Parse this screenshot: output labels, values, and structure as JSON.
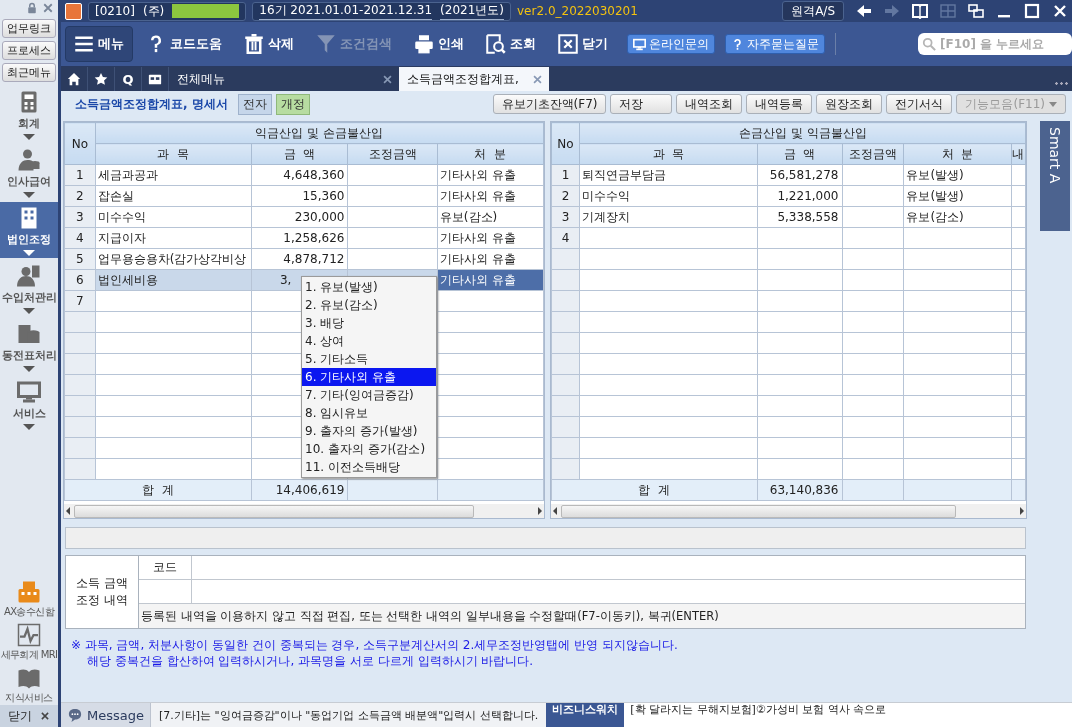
{
  "title_bar": {
    "company_code": "[0210]",
    "company": "(주)",
    "period": "16기  2021.01.01-2021.12.31",
    "fiscal_year": "(2021년도)",
    "version": "ver2.0_2022030201",
    "remote_button": "원격A/S"
  },
  "sidebar": {
    "quick_buttons": [
      "업무링크",
      "프로세스",
      "최근메뉴"
    ],
    "items": [
      {
        "label": "회계",
        "kind": "calculator",
        "selected": false
      },
      {
        "label": "인사급여",
        "kind": "person",
        "selected": false
      },
      {
        "label": "법인조정",
        "kind": "building",
        "selected": true
      },
      {
        "label": "수입처관리",
        "kind": "people",
        "selected": false
      },
      {
        "label": "동전표처리",
        "kind": "database",
        "selected": false
      },
      {
        "label": "서비스",
        "kind": "monitor",
        "selected": false
      }
    ],
    "bottom_items": [
      {
        "label": "AX송수신함",
        "kind": "fax"
      },
      {
        "label": "세무회계 MRI",
        "kind": "pulse"
      },
      {
        "label": "지식서비스",
        "kind": "book"
      }
    ],
    "close": "닫기"
  },
  "toolbar": {
    "buttons": [
      {
        "label": "메뉴",
        "kind": "menu",
        "disabled": false
      },
      {
        "label": "코드도움",
        "kind": "question",
        "disabled": false
      },
      {
        "label": "삭제",
        "kind": "trash",
        "disabled": false
      },
      {
        "label": "조건검색",
        "kind": "filter",
        "disabled": true
      },
      {
        "label": "인쇄",
        "kind": "printer",
        "disabled": false
      },
      {
        "label": "조회",
        "kind": "lookup",
        "disabled": false
      },
      {
        "label": "닫기",
        "kind": "closebox",
        "disabled": false
      }
    ],
    "help_buttons": [
      {
        "label": "온라인문의",
        "kind": "monitor"
      },
      {
        "label": "자주묻는질문",
        "kind": "question"
      }
    ],
    "search": {
      "placeholder": "[F10] 을 누르세요"
    }
  },
  "tab_bar": {
    "quick_search": "Q",
    "tabs": [
      {
        "label": "전체메뉴",
        "selected": false
      },
      {
        "label": "소득금액조정합계표,",
        "selected": true
      }
    ]
  },
  "form": {
    "title": "소득금액조정합계표, 명세서",
    "badges": [
      {
        "label": "전자",
        "kind": "plain"
      },
      {
        "label": "개정",
        "kind": "green"
      }
    ],
    "buttons": [
      {
        "label": "유보기초잔액(F7)",
        "disabled": false
      },
      {
        "label": "저장",
        "disabled": false
      },
      {
        "label": "내역조회",
        "disabled": false
      },
      {
        "label": "내역등록",
        "disabled": false
      },
      {
        "label": "원장조회",
        "disabled": false
      },
      {
        "label": "전기서식",
        "disabled": false
      },
      {
        "label": "기능모음(F11)",
        "disabled": true
      }
    ]
  },
  "left_table": {
    "group_header": "익금산입 및 손금불산입",
    "columns": [
      "No",
      "과  목",
      "금  액",
      "조정금액",
      "처  분"
    ],
    "rows": [
      {
        "no": "1",
        "subject": "세금과공과",
        "amount": "4,648,360",
        "disposal": "기타사외 유출",
        "selected": false
      },
      {
        "no": "2",
        "subject": "잡손실",
        "amount": "15,360",
        "disposal": "기타사외 유출",
        "selected": false
      },
      {
        "no": "3",
        "subject": "미수수익",
        "amount": "230,000",
        "disposal": "유보(감소)",
        "selected": false
      },
      {
        "no": "4",
        "subject": "지급이자",
        "amount": "1,258,626",
        "disposal": "기타사외 유출",
        "selected": false
      },
      {
        "no": "5",
        "subject": "업무용승용차(감가상각비상",
        "amount": "4,878,712",
        "disposal": "기타사외 유출",
        "selected": false
      },
      {
        "no": "6",
        "subject": "법인세비용",
        "amount": "3,",
        "disposal": "기타사외 유출",
        "selected": true
      },
      {
        "no": "7",
        "selected": false
      }
    ],
    "total_label": "합  계",
    "total": "14,406,619"
  },
  "disposal_dropdown": {
    "items": [
      {
        "label": "1. 유보(발생)",
        "selected": false
      },
      {
        "label": "2. 유보(감소)",
        "selected": false
      },
      {
        "label": "3. 배당",
        "selected": false
      },
      {
        "label": "4. 상여",
        "selected": false
      },
      {
        "label": "5. 기타소득",
        "selected": false
      },
      {
        "label": "6. 기타사외 유출",
        "selected": true
      },
      {
        "label": "7. 기타(잉여금증감)",
        "selected": false
      },
      {
        "label": "8. 임시유보",
        "selected": false
      },
      {
        "label": "9. 출자의 증가(발생)",
        "selected": false
      },
      {
        "label": "10. 출자의 증가(감소)",
        "selected": false
      },
      {
        "label": "11. 이전소득배당",
        "selected": false
      }
    ]
  },
  "right_table": {
    "group_header": "손금산입 및 익금불산입",
    "columns": [
      "No",
      "과  목",
      "금  액",
      "조정금액",
      "처  분",
      "내"
    ],
    "rows": [
      {
        "no": "1",
        "subject": "퇴직연금부담금",
        "amount": "56,581,278",
        "disposal": "유보(발생)",
        "selected": false
      },
      {
        "no": "2",
        "subject": "미수수익",
        "amount": "1,221,000",
        "disposal": "유보(발생)",
        "selected": false
      },
      {
        "no": "3",
        "subject": "기계장치",
        "amount": "5,338,558",
        "disposal": "유보(감소)",
        "selected": false
      },
      {
        "no": "4",
        "selected": false
      }
    ],
    "total_label": "합  계",
    "total": "63,140,836"
  },
  "smart_tab": "Smart A",
  "detail": {
    "label": "소득 금액\n조정 내역",
    "code_label": "코드",
    "hint": "등록된 내역을 이용하지 않고 직접 편집, 또는 선택한 내역의 일부내용을 수정할때(F7-이동키), 복귀(ENTER)"
  },
  "notes": [
    "※ 과목, 금액, 처분사항이 동일한 건이 중복되는 경우, 소득구분계산서의 2.세무조정반영탭에 반영 되지않습니다.",
    "해당 중복건을 합산하여 입력하시거나, 과목명을 서로 다르게 입력하시기 바랍니다."
  ],
  "status_bar": {
    "message_button": "Message",
    "message": "[7.기타]는 \"잉여금증감\"이나 \"동업기업 소득금액 배분액\"입력시 선택합니다.",
    "news_source": "비즈니스워치",
    "news": "[확 달라지는 무해지보험]②가성비 보험 역사 속으로"
  }
}
